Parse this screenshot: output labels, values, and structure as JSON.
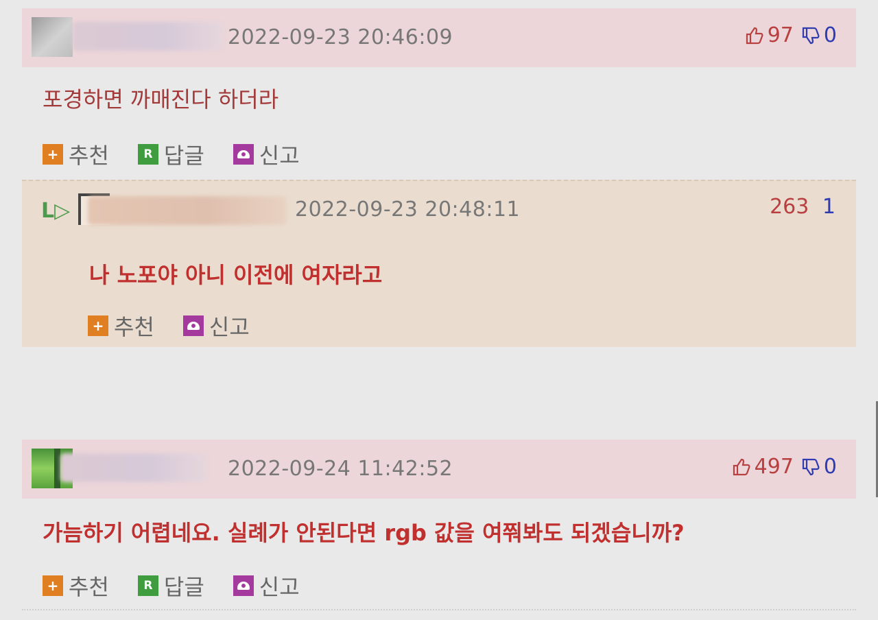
{
  "comments": [
    {
      "timestamp": "2022-09-23 20:46:09",
      "upvotes": "97",
      "downvotes": "0",
      "content": "포경하면 까매진다 하더라",
      "actions": {
        "recommend": "추천",
        "reply": "답글",
        "report": "신고"
      },
      "reply_icon_letter": "R"
    },
    {
      "timestamp": "2022-09-24 11:42:52",
      "upvotes": "497",
      "downvotes": "0",
      "content": "가늠하기 어렵네요. 실례가 안된다면 rgb 값을 여쭤봐도 되겠습니까?",
      "actions": {
        "recommend": "추천",
        "reply": "답글",
        "report": "신고"
      },
      "reply_icon_letter": "R"
    }
  ],
  "reply": {
    "arrow": "L▷",
    "timestamp": "2022-09-23 20:48:11",
    "upvotes": "263",
    "downvotes": "1",
    "content": "나 노포야 아니 이전에 여자라고",
    "actions": {
      "recommend": "추천",
      "report": "신고"
    }
  },
  "colors": {
    "header_bg": "#ecd6d9",
    "reply_bg": "#eaddd0",
    "upvote": "#b84040",
    "downvote": "#2f3bb0",
    "recommend_icon": "#e07f22",
    "reply_icon": "#3f9c3f",
    "report_icon": "#a43a9e"
  },
  "icons": [
    "thumbs-up-icon",
    "thumbs-down-icon",
    "plus-icon",
    "reply-icon",
    "siren-icon",
    "reply-arrow-icon"
  ]
}
